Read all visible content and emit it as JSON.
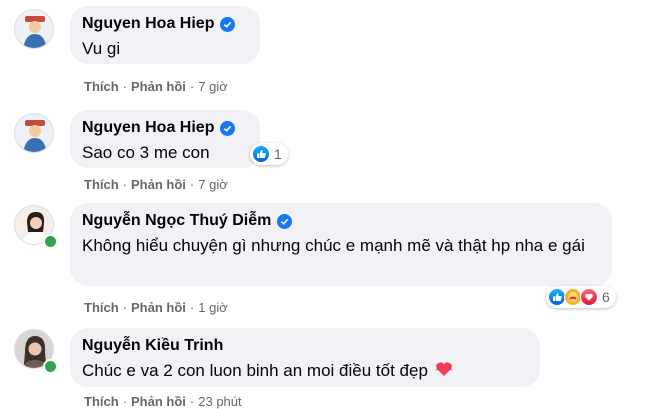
{
  "actions": {
    "like_label": "Thích",
    "reply_label": "Phản hồi",
    "separator": "·"
  },
  "comments": [
    {
      "author": "Nguyen Hoa Hiep",
      "text": "Vu gi",
      "time": "7 giờ"
    },
    {
      "author": "Nguyen Hoa Hiep",
      "text": "Sao co 3 me con",
      "time": "7 giờ",
      "reaction_count": "1"
    },
    {
      "author": "Nguyễn Ngọc Thuý Diễm",
      "text": "Không hiểu chuyện gì nhưng chúc e mạnh mẽ và thật hp nha e gái",
      "time": "1 giờ",
      "reaction_count": "6"
    },
    {
      "author": "Nguyễn Kiều Trinh",
      "text": "Chúc e va 2 con luon binh an moi điều tốt đẹp",
      "time": "23 phút"
    }
  ],
  "colors": {
    "bubble": "#f0f2f5",
    "name": "#050505",
    "meta": "#65676b",
    "verified": "#1877f2",
    "like": "#1877f2",
    "love": "#f33e58",
    "online": "#31a24c"
  }
}
